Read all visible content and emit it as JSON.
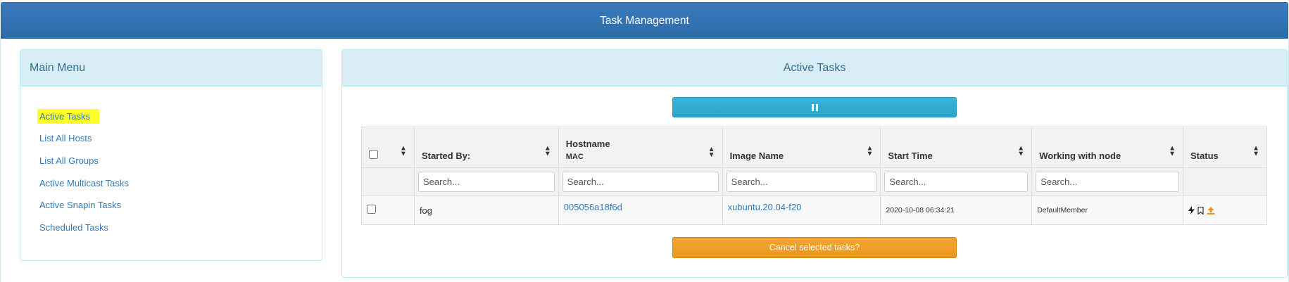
{
  "header": {
    "title": "Task Management"
  },
  "menu": {
    "title": "Main Menu",
    "items": [
      {
        "label": "Active Tasks",
        "active": true
      },
      {
        "label": "List All Hosts"
      },
      {
        "label": "List All Groups"
      },
      {
        "label": "Active Multicast Tasks"
      },
      {
        "label": "Active Snapin Tasks"
      },
      {
        "label": "Scheduled Tasks"
      }
    ]
  },
  "tasks": {
    "title": "Active Tasks",
    "pause_icon": "pause-icon",
    "columns": {
      "started_by": "Started By:",
      "hostname": "Hostname",
      "mac": "MAC",
      "image_name": "Image Name",
      "start_time": "Start Time",
      "node": "Working with node",
      "status": "Status"
    },
    "search_placeholder": "Search...",
    "rows": [
      {
        "started_by": "fog",
        "hostname": "005056a18f6d",
        "image_name": "xubuntu.20.04-f20",
        "start_time": "2020-10-08 06:34:21",
        "node": "DefaultMember",
        "status_icons": [
          "bolt-icon",
          "bookmark-icon",
          "upload-icon"
        ]
      }
    ],
    "cancel_label": "Cancel selected tasks?"
  },
  "colors": {
    "header_blue": "#2d6ca8",
    "panel_heading": "#d9edf7",
    "link": "#337ab7",
    "info_button": "#31b0d5",
    "warning_button": "#ec971f",
    "highlight": "#ffff2c"
  }
}
